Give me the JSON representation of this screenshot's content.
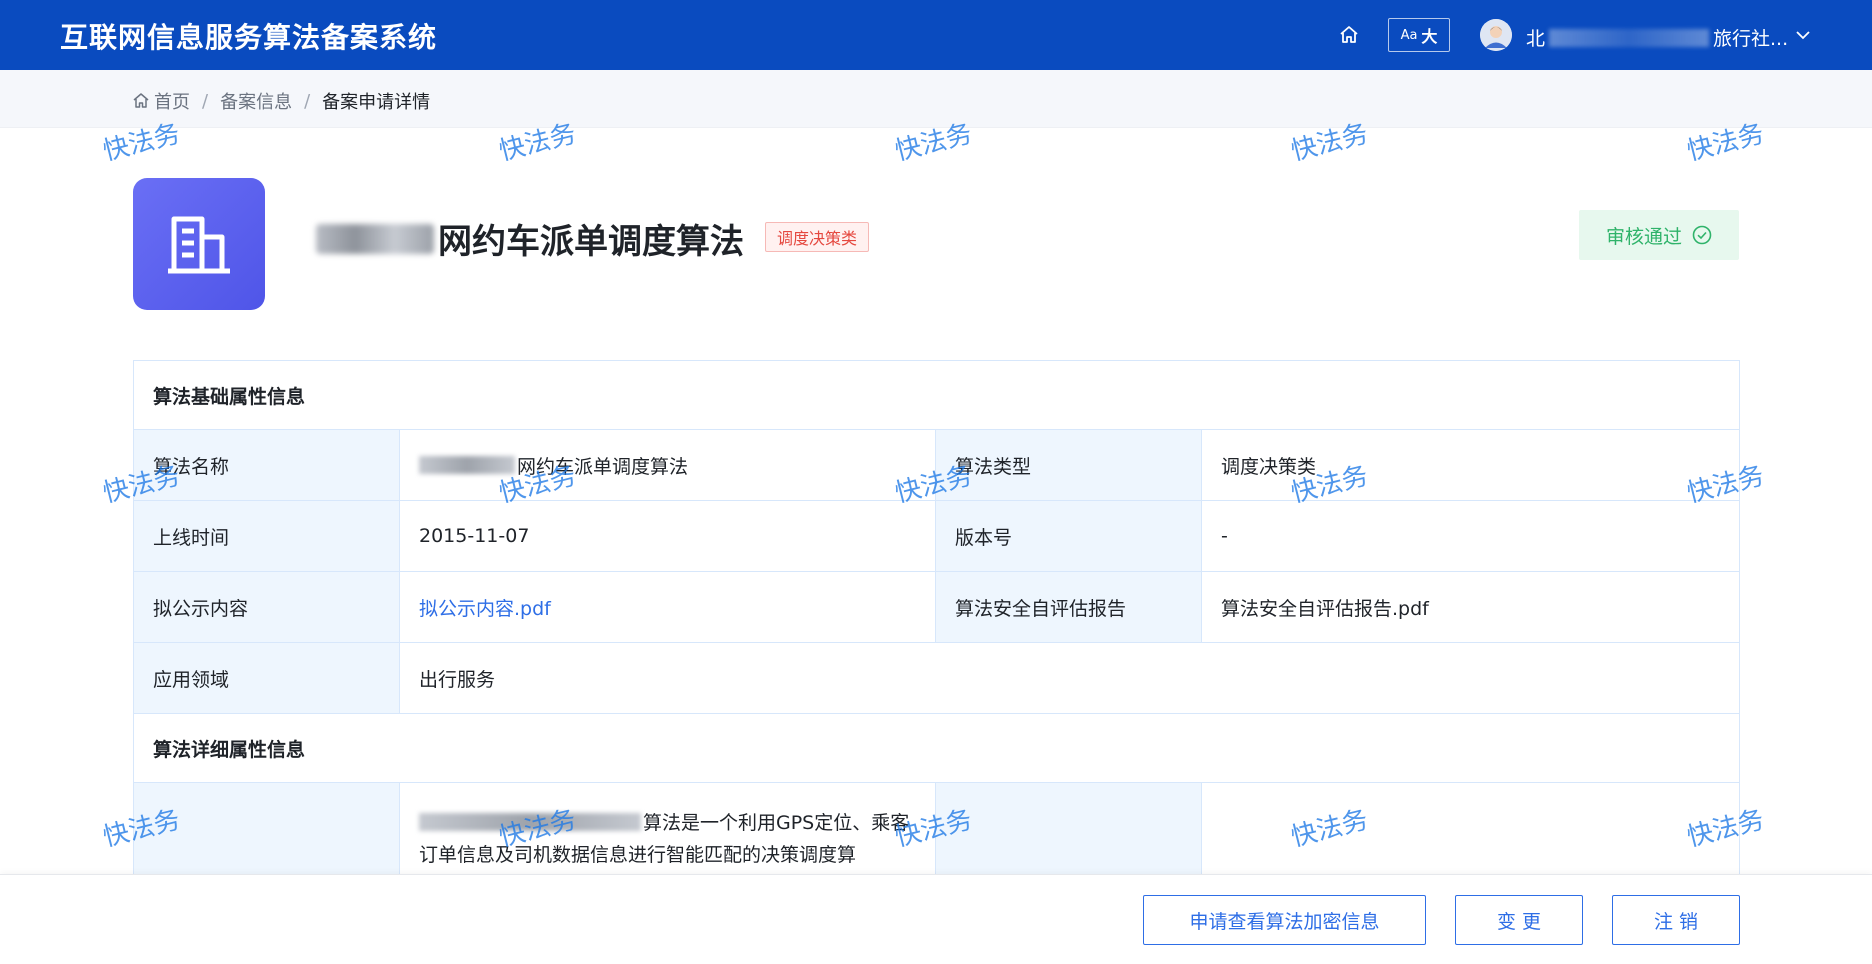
{
  "header": {
    "app_title": "互联网信息服务算法备案系统",
    "font_size_label": "Aa",
    "font_size_value": "大",
    "user_name_prefix": "北",
    "user_name_suffix": "旅行社..."
  },
  "breadcrumb": {
    "items": [
      "首页",
      "备案信息",
      "备案申请详情"
    ]
  },
  "hero": {
    "title_visible": "网约车派单调度算法",
    "tag": "调度决策类",
    "status": "审核通过"
  },
  "basic": {
    "section_title": "算法基础属性信息",
    "rows": [
      {
        "label1": "算法名称",
        "value1": "网约车派单调度算法",
        "label2": "算法类型",
        "value2": "调度决策类"
      },
      {
        "label1": "上线时间",
        "value1": "2015-11-07",
        "label2": "版本号",
        "value2": "-"
      },
      {
        "label1": "拟公示内容",
        "value1": "拟公示内容.pdf",
        "label2": "算法安全自评估报告",
        "value2": "算法安全自评估报告.pdf"
      }
    ],
    "domain_label": "应用领域",
    "domain_value": "出行服务"
  },
  "detail": {
    "section_title": "算法详细属性信息",
    "desc_line1": "算法是一个利用GPS定位、乘客",
    "desc_line2": "订单信息及司机数据信息进行智能匹配的决策调度算"
  },
  "footer": {
    "request_button": "申请查看算法加密信息",
    "change_button": "变 更",
    "cancel_button": "注 销"
  },
  "watermark_text": "快法务"
}
